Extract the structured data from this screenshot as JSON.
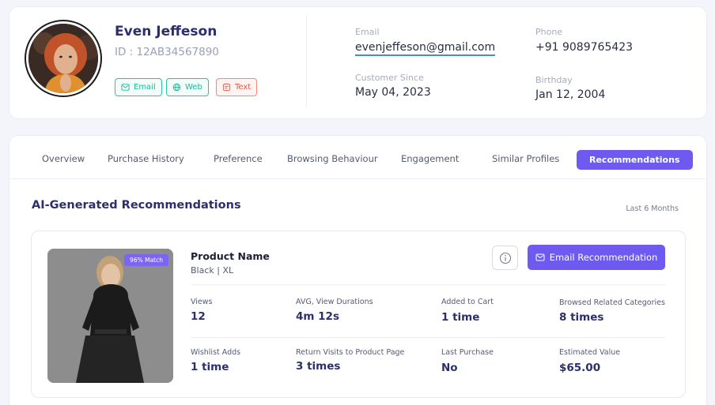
{
  "profile": {
    "name": "Even Jeffeson",
    "id": "ID : 12AB34567890",
    "chips": {
      "email": "Email",
      "web": "Web",
      "text": "Text"
    },
    "email_label": "Email",
    "email_value": "evenjeffeson@gmail.com",
    "phone_label": "Phone",
    "phone_value": "+91 9089765423",
    "since_label": "Customer Since",
    "since_value": "May 04, 2023",
    "birthday_label": "Birthday",
    "birthday_value": "Jan 12, 2004"
  },
  "tabs": [
    {
      "label": "Overview"
    },
    {
      "label": "Purchase History"
    },
    {
      "label": "Preference"
    },
    {
      "label": "Browsing Behaviour"
    },
    {
      "label": "Engagement"
    },
    {
      "label": "Similar Profiles"
    },
    {
      "label": "Recommendations",
      "active": true
    }
  ],
  "section": {
    "title": "AI-Generated Recommendations",
    "period": "Last 6 Months"
  },
  "recommendation": {
    "match": "96% Match",
    "product_name": "Product Name",
    "variant": "Black | XL",
    "email_button": "Email Recommendation",
    "metrics": [
      {
        "label": "Views",
        "value": "12"
      },
      {
        "label": "AVG, View Durations",
        "value": "4m 12s"
      },
      {
        "label": "Added to Cart",
        "value": "1 time"
      },
      {
        "label": "Browsed Related Categories",
        "value": "8 times"
      },
      {
        "label": "Wishlist Adds",
        "value": "1 time"
      },
      {
        "label": "Return Visits to Product Page",
        "value": "3 times"
      },
      {
        "label": "Last Purchase",
        "value": "No"
      },
      {
        "label": "Estimated Value",
        "value": "$65.00"
      }
    ]
  },
  "colors": {
    "accent": "#6e5af0",
    "heading": "#2b2f6e",
    "chip_green": "#2ac3a4",
    "chip_red": "#ef8a7b",
    "link_underline": "#3c8ce8"
  }
}
